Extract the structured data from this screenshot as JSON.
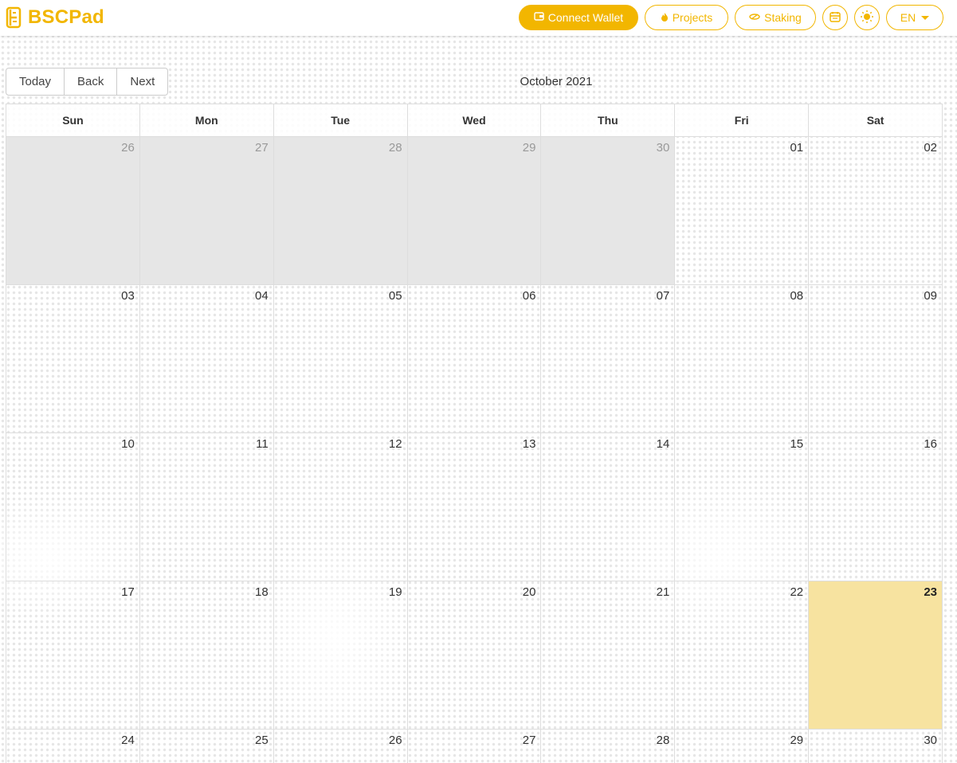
{
  "brand": {
    "name": "BSCPad",
    "color": "#f2b600"
  },
  "nav": {
    "connect_wallet": "Connect Wallet",
    "projects": "Projects",
    "staking": "Staking",
    "language": "EN"
  },
  "toolbar": {
    "today": "Today",
    "back": "Back",
    "next": "Next",
    "month_label": "October 2021"
  },
  "calendar": {
    "weekdays": [
      "Sun",
      "Mon",
      "Tue",
      "Wed",
      "Thu",
      "Fri",
      "Sat"
    ],
    "weeks": [
      [
        "26",
        "27",
        "28",
        "29",
        "30",
        "01",
        "02"
      ],
      [
        "03",
        "04",
        "05",
        "06",
        "07",
        "08",
        "09"
      ],
      [
        "10",
        "11",
        "12",
        "13",
        "14",
        "15",
        "16"
      ],
      [
        "17",
        "18",
        "19",
        "20",
        "21",
        "22",
        "23"
      ],
      [
        "24",
        "25",
        "26",
        "27",
        "28",
        "29",
        "30"
      ]
    ],
    "today_highlight_color": "#f7e3a0",
    "off_range_color": "#e6e6e6"
  }
}
